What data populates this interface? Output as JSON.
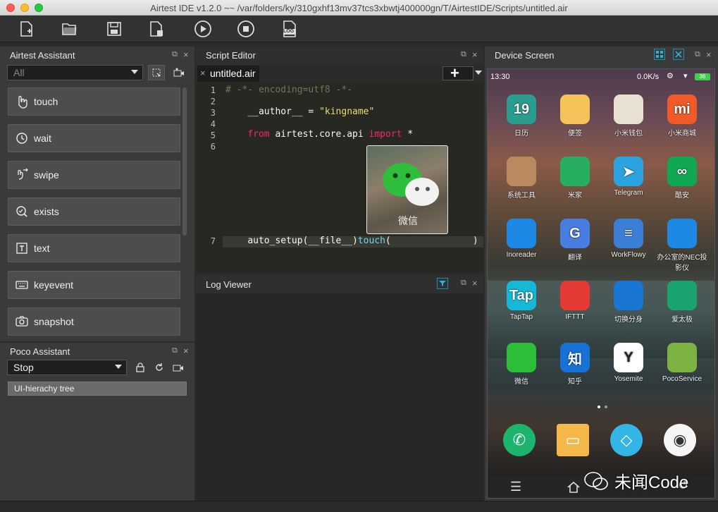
{
  "window": {
    "title": "Airtest IDE v1.2.0 ~~ /var/folders/ky/310gxhf13mv37tcs3xbwtj400000gn/T/AirtestIDE/Scripts/untitled.air"
  },
  "toolbar": {
    "icons": [
      "new-file-icon",
      "open-folder-icon",
      "save-icon",
      "save-as-icon",
      "run-icon",
      "stop-icon",
      "log-icon"
    ],
    "log_label": "LOG"
  },
  "assistant": {
    "title": "Airtest Assistant",
    "mode_value": "All",
    "commands": [
      {
        "label": "touch",
        "icon": "hand-pointer-icon"
      },
      {
        "label": "wait",
        "icon": "clock-icon"
      },
      {
        "label": "swipe",
        "icon": "swipe-icon"
      },
      {
        "label": "exists",
        "icon": "search-icon"
      },
      {
        "label": "text",
        "icon": "text-icon"
      },
      {
        "label": "keyevent",
        "icon": "keyboard-icon"
      },
      {
        "label": "snapshot",
        "icon": "camera-icon"
      }
    ]
  },
  "poco": {
    "title": "Poco Assistant",
    "mode_value": "Stop",
    "tree_label": "UI-hierachy tree"
  },
  "editor": {
    "title": "Script Editor",
    "tab_label": "untitled.air",
    "close_glyph": "×",
    "add_glyph": "+",
    "line_numbers": [
      "1",
      "2",
      "3",
      "4",
      "5",
      "6",
      "7"
    ],
    "line1": "# -*- encoding=utf8 -*-",
    "line2_a": "__author__ = ",
    "line2_b": "\"kingname\"",
    "line4_from": "from",
    "line4_mod": " airtest.core.api ",
    "line4_import": "import",
    "line4_star": " *",
    "line6_a": "auto_setup(__file__)",
    "line6_b": "touch",
    "line6_c": "(",
    "line6_d": ")",
    "template_caption": "微信"
  },
  "log": {
    "title": "Log Viewer"
  },
  "device": {
    "title": "Device Screen",
    "status_time": "13:30",
    "status_right": "0.0K/s",
    "battery": "36",
    "apps": [
      {
        "label": "日历",
        "glyph": "19",
        "color": "#2a9d8f"
      },
      {
        "label": "便签",
        "glyph": "",
        "color": "#f4c45a"
      },
      {
        "label": "小米钱包",
        "glyph": "",
        "color": "#e8e0d0"
      },
      {
        "label": "小米商城",
        "glyph": "mi",
        "color": "#f05a28"
      },
      {
        "label": "系统工具",
        "glyph": "",
        "color": "#b98a60"
      },
      {
        "label": "米家",
        "glyph": "",
        "color": "#27ae60"
      },
      {
        "label": "Telegram",
        "glyph": "➤",
        "color": "#2aa3e0"
      },
      {
        "label": "酷安",
        "glyph": "∞",
        "color": "#11a853"
      },
      {
        "label": "Inoreader",
        "glyph": "",
        "color": "#1e88e5"
      },
      {
        "label": "翻译",
        "glyph": "G",
        "color": "#4a7de0"
      },
      {
        "label": "WorkFlowy",
        "glyph": "≡",
        "color": "#3c7fd6"
      },
      {
        "label": "办公室的NEC投影仪",
        "glyph": "",
        "color": "#1e88e5"
      },
      {
        "label": "TapTap",
        "glyph": "Tap",
        "color": "#16b8d8"
      },
      {
        "label": "IFTTT",
        "glyph": "",
        "color": "#e53935"
      },
      {
        "label": "切换分身",
        "glyph": "",
        "color": "#1976d2"
      },
      {
        "label": "爱太极",
        "glyph": "",
        "color": "#1aa36e"
      },
      {
        "label": "微信",
        "glyph": "",
        "color": "#2ebd39"
      },
      {
        "label": "知乎",
        "glyph": "知",
        "color": "#1772d6"
      },
      {
        "label": "Yosemite",
        "glyph": "Y",
        "color": "#ffffff"
      },
      {
        "label": "PocoService",
        "glyph": "",
        "color": "#7cb342"
      }
    ],
    "dock": [
      {
        "name": "phone-icon",
        "color": "#1db46e"
      },
      {
        "name": "messages-icon",
        "color": "#f4b74a"
      },
      {
        "name": "browser-icon",
        "color": "#33b5e5"
      },
      {
        "name": "camera-app-icon",
        "color": "#f5f5f5"
      }
    ],
    "watermark": "未闻Code"
  },
  "colors": {
    "accent": "#1a8fb3",
    "editor_bg": "#272822"
  }
}
